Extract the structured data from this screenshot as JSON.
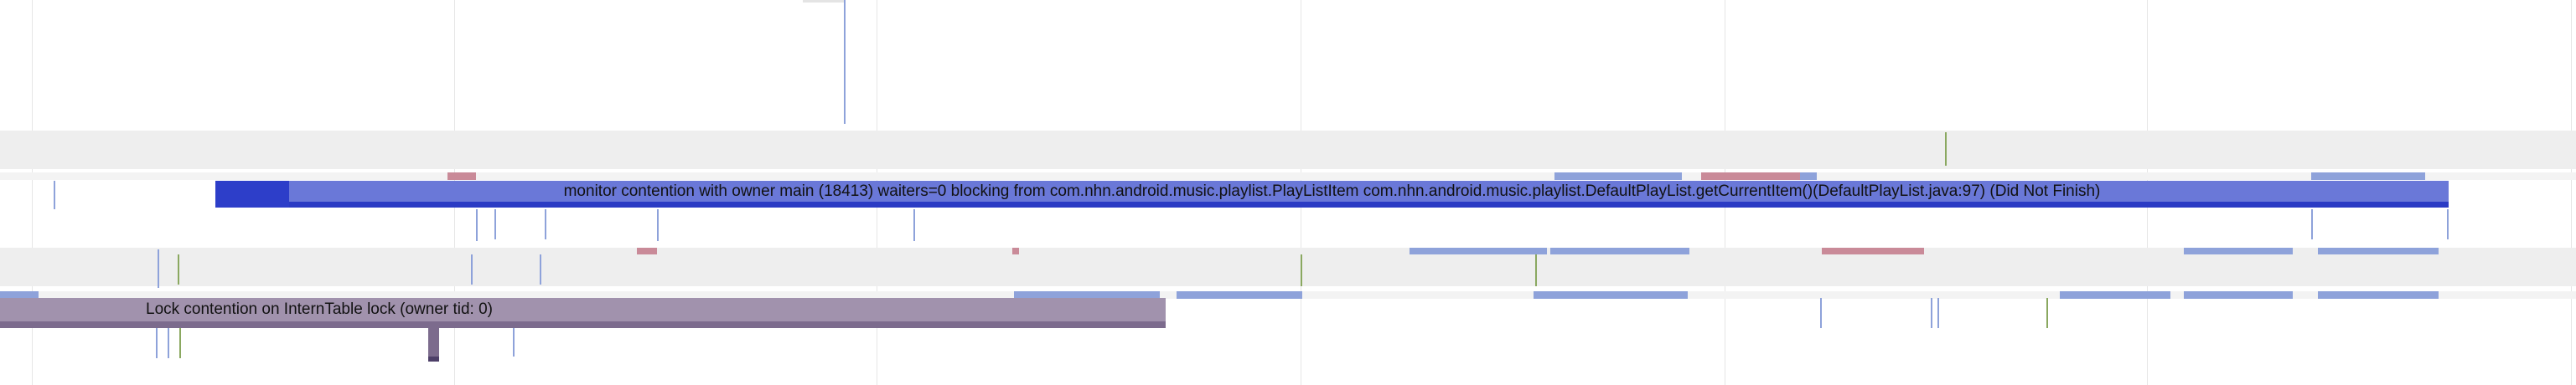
{
  "trace": {
    "slices": {
      "monitor_contention": "monitor contention with owner main (18413) waiters=0 blocking from com.nhn.android.music.playlist.PlayListItem com.nhn.android.music.playlist.DefaultPlayList.getCurrentItem()(DefaultPlayList.java:97) (Did Not Finish)",
      "lock_contention": "Lock contention on InternTable lock (owner tid: 0)"
    }
  },
  "colors": {
    "track_band": "#eeeeee",
    "monitor_slice": "#6a78d8",
    "monitor_slice_dark": "#2a3bc4",
    "lock_slice": "#a192ad",
    "lock_slice_dark": "#7c6b8d",
    "blue_marker": "#8ea2da",
    "red_marker": "#c98a98",
    "green_marker": "#8aa860"
  }
}
